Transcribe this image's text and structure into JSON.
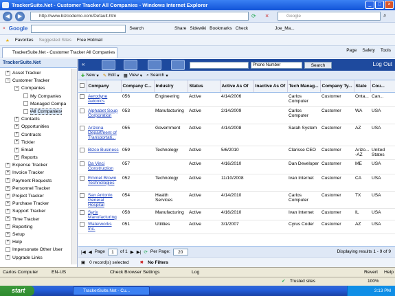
{
  "window": {
    "title": "TrackerSuite.Net - Customer Tracker All Companies - Windows Internet Explorer"
  },
  "address": {
    "url": "http://www.bizcodemo.com/Default.htm",
    "search_placeholder": "Google"
  },
  "google_bar": {
    "logo": "Google",
    "items": [
      "Search",
      "Share",
      "Sidewiki",
      "Bookmarks",
      "Check",
      "Joe_Ma..."
    ]
  },
  "favorites_bar": {
    "items": [
      "Favorites",
      "Suggested Sites",
      "Free Hotmail"
    ]
  },
  "tab": {
    "label": "TrackerSuite.Net - Customer Tracker All Companies"
  },
  "ie_tools": [
    "Page",
    "Safety",
    "Tools"
  ],
  "sidebar": {
    "title": "TrackerSuite.Net",
    "items": [
      {
        "label": "Asset Tracker",
        "level": 0,
        "kind": "expand"
      },
      {
        "label": "Customer Tracker",
        "level": 0,
        "kind": "collapse"
      },
      {
        "label": "Companies",
        "level": 1,
        "kind": "collapse"
      },
      {
        "label": "My Companies",
        "level": 2,
        "kind": "leaf"
      },
      {
        "label": "Managed Compa",
        "level": 2,
        "kind": "leaf"
      },
      {
        "label": "All Companies",
        "level": 2,
        "kind": "leaf",
        "selected": true
      },
      {
        "label": "Contacts",
        "level": 1,
        "kind": "expand"
      },
      {
        "label": "Opportunities",
        "level": 1,
        "kind": "expand"
      },
      {
        "label": "Contracts",
        "level": 1,
        "kind": "expand"
      },
      {
        "label": "Tickler",
        "level": 1,
        "kind": "expand"
      },
      {
        "label": "Email",
        "level": 1,
        "kind": "expand"
      },
      {
        "label": "Reports",
        "level": 1,
        "kind": "expand"
      },
      {
        "label": "Expense Tracker",
        "level": 0,
        "kind": "expand"
      },
      {
        "label": "Invoice Tracker",
        "level": 0,
        "kind": "expand"
      },
      {
        "label": "Payment Requests",
        "level": 0,
        "kind": "expand"
      },
      {
        "label": "Personnel Tracker",
        "level": 0,
        "kind": "expand"
      },
      {
        "label": "Project Tracker",
        "level": 0,
        "kind": "expand"
      },
      {
        "label": "Purchase Tracker",
        "level": 0,
        "kind": "expand"
      },
      {
        "label": "Support Tracker",
        "level": 0,
        "kind": "expand"
      },
      {
        "label": "Time Tracker",
        "level": 0,
        "kind": "expand"
      },
      {
        "label": "Reporting",
        "level": 0,
        "kind": "expand"
      },
      {
        "label": "Setup",
        "level": 0,
        "kind": "expand"
      },
      {
        "label": "Help",
        "level": 0,
        "kind": "expand"
      },
      {
        "label": "Impersonate Other User",
        "level": 0,
        "kind": "leaf"
      },
      {
        "label": "Upgrade Links",
        "level": 0,
        "kind": "expand"
      }
    ]
  },
  "header": {
    "search_field": "Phone Number",
    "search_button": "Search",
    "logout": "Log Out"
  },
  "toolbar": {
    "new": "New",
    "edit": "Edit",
    "view": "View",
    "search": "Search"
  },
  "grid": {
    "columns": [
      "Company",
      "Company C...",
      "Industry",
      "Status",
      "Active As Of",
      "Inactive As Of",
      "Tech Manag...",
      "Company Ty...",
      "State",
      "Cou..."
    ],
    "rows": [
      [
        "Aerodyne Avionics",
        "056",
        "Engineering",
        "Active",
        "4/14/2006",
        "",
        "Carlos Computer",
        "Customer",
        "Onta...",
        "Can..."
      ],
      [
        "Alphabet Soup Corporation",
        "053",
        "Manufacturing",
        "Active",
        "2/14/2009",
        "",
        "Carlos Computer",
        "Customer",
        "WA",
        "USA"
      ],
      [
        "Arizona Department of Transportati...",
        "055",
        "Government",
        "Active",
        "4/14/2008",
        "",
        "Sarah System",
        "Customer",
        "AZ",
        "USA"
      ],
      [
        "Bizco Business",
        "059",
        "Technology",
        "Active",
        "5/6/2010",
        "",
        "Clarisse CEO",
        "Customer",
        "Arizo... -AZ",
        "United States"
      ],
      [
        "Da Vinci Construction",
        "057",
        "",
        "Active",
        "4/16/2010",
        "",
        "Dan Developer",
        "Customer",
        "ME",
        "USA"
      ],
      [
        "Emmet Brown Technologies",
        "052",
        "Technology",
        "Active",
        "11/10/2008",
        "",
        "Ivan Internet",
        "Customer",
        "CA",
        "USA"
      ],
      [
        "San Antonio General Hospital",
        "054",
        "Health Services",
        "Active",
        "4/14/2010",
        "",
        "Carlos Computer",
        "Customer",
        "TX",
        "USA"
      ],
      [
        "Syrix Manufacturing",
        "058",
        "Manufacturing",
        "Active",
        "4/16/2010",
        "",
        "Ivan Internet",
        "Customer",
        "IL",
        "USA"
      ],
      [
        "Waterworks Inc.",
        "051",
        "Utilities",
        "Active",
        "3/1/2007",
        "",
        "Cyrus Coder",
        "Customer",
        "AZ",
        "USA"
      ]
    ]
  },
  "pager": {
    "page_label": "Page",
    "page": "1",
    "of": "of 1",
    "per_page_label": "Per Page:",
    "per_page": "20",
    "display": "Displaying results 1 - 9 of 9"
  },
  "selection": {
    "selected": "0 record(s) selected",
    "filters": "No Filters"
  },
  "app_status": {
    "user": "Carlos Computer",
    "locale": "EN-US",
    "settings": "Check Browser Settings",
    "log": "Log",
    "revert": "Revert",
    "help": "Help"
  },
  "ie_status": {
    "zone": "Trusted sites",
    "zoom": "100%"
  },
  "taskbar": {
    "start": "start",
    "task": "TrackerSuite.Net - Cu...",
    "clock": "3:13 PM"
  }
}
